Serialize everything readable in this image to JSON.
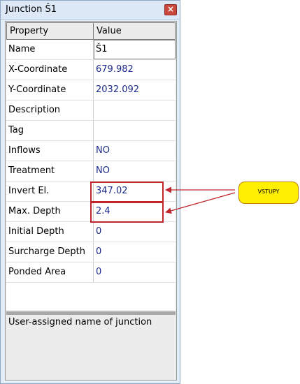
{
  "window": {
    "title": "Junction Š1",
    "close_glyph": "×"
  },
  "grid": {
    "header": {
      "property": "Property",
      "value": "Value"
    },
    "rows": [
      {
        "property": "Name",
        "value": "Š1",
        "editing": true
      },
      {
        "property": "X-Coordinate",
        "value": "679.982"
      },
      {
        "property": "Y-Coordinate",
        "value": "2032.092"
      },
      {
        "property": "Description",
        "value": ""
      },
      {
        "property": "Tag",
        "value": ""
      },
      {
        "property": "Inflows",
        "value": "NO"
      },
      {
        "property": "Treatment",
        "value": "NO"
      },
      {
        "property": "Invert El.",
        "value": "347.02",
        "highlighted": true
      },
      {
        "property": "Max. Depth",
        "value": "2.4",
        "highlighted": true
      },
      {
        "property": "Initial Depth",
        "value": "0"
      },
      {
        "property": "Surcharge Depth",
        "value": "0"
      },
      {
        "property": "Ponded Area",
        "value": "0"
      }
    ]
  },
  "description": "User-assigned name of junction",
  "annotation": {
    "callout_label": "VSTUPY",
    "callout_color": "#ffef00",
    "highlight_color": "#c0272d"
  }
}
